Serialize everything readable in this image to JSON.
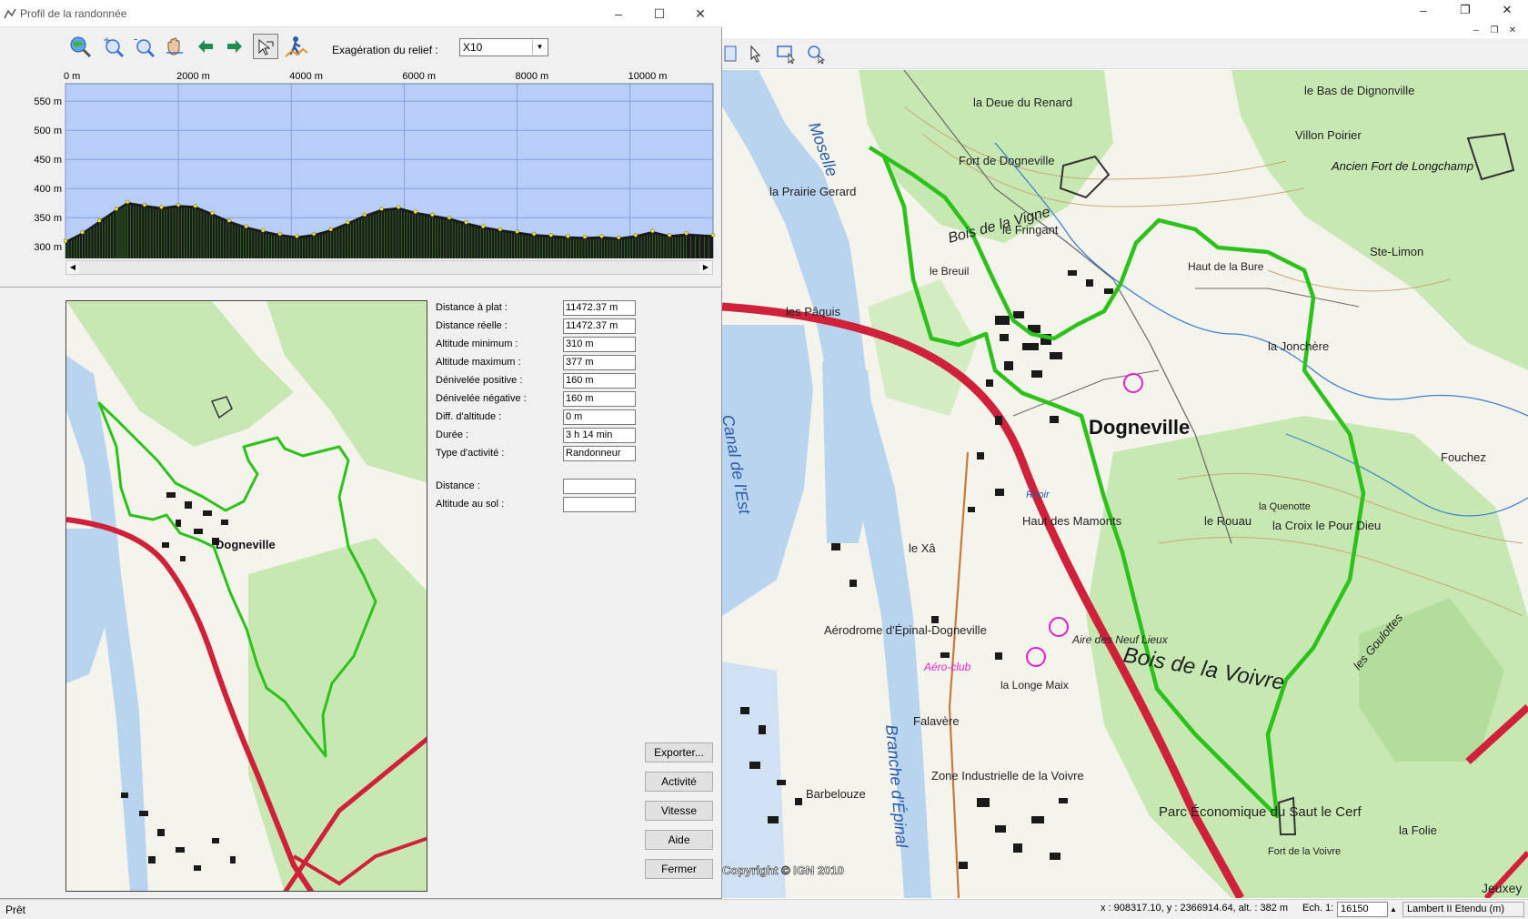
{
  "dialog": {
    "title": "Profil de la randonnée",
    "toolbar": {
      "relief_label": "Exagération du relief :",
      "relief_value": "X10"
    }
  },
  "profile": {
    "x_ticks": [
      "0 m",
      "2000 m",
      "4000 m",
      "6000 m",
      "8000 m",
      "10000 m"
    ],
    "y_ticks": [
      "550 m",
      "500 m",
      "450 m",
      "400 m",
      "350 m",
      "300 m"
    ]
  },
  "chart_data": {
    "type": "area",
    "title": "",
    "xlabel": "",
    "ylabel": "",
    "x_unit": "m",
    "y_unit": "m",
    "xlim": [
      0,
      11472
    ],
    "ylim": [
      280,
      580
    ],
    "grid": true,
    "fill_color": "#1a1a1a",
    "background_color": "#b8cdf7",
    "x": [
      0,
      300,
      600,
      900,
      1100,
      1400,
      1700,
      2000,
      2300,
      2600,
      2900,
      3200,
      3500,
      3800,
      4100,
      4400,
      4700,
      5000,
      5300,
      5600,
      5900,
      6200,
      6500,
      6800,
      7100,
      7400,
      7700,
      8000,
      8300,
      8600,
      8900,
      9200,
      9500,
      9800,
      10100,
      10400,
      10700,
      11000,
      11472
    ],
    "y": [
      310,
      325,
      345,
      365,
      377,
      372,
      368,
      372,
      370,
      358,
      345,
      335,
      328,
      322,
      318,
      322,
      330,
      342,
      355,
      365,
      368,
      360,
      355,
      350,
      342,
      335,
      330,
      326,
      322,
      320,
      318,
      317,
      318,
      316,
      320,
      327,
      320,
      323,
      320
    ]
  },
  "stats": [
    {
      "label": "Distance à plat :",
      "value": "11472.37 m"
    },
    {
      "label": "Distance réelle :",
      "value": "11472.37 m"
    },
    {
      "label": "Altitude minimum :",
      "value": "310 m"
    },
    {
      "label": "Altitude maximum :",
      "value": "377 m"
    },
    {
      "label": "Dénivelée positive :",
      "value": "160 m"
    },
    {
      "label": "Dénivelée négative :",
      "value": "160 m"
    },
    {
      "label": "Diff. d'altitude :",
      "value": "0 m"
    },
    {
      "label": "Durée :",
      "value": "3 h 14 min"
    },
    {
      "label": "Type d'activité :",
      "value": "Randonneur"
    }
  ],
  "cursor_stats": [
    {
      "label": "Distance :",
      "value": ""
    },
    {
      "label": "Altitude au sol :",
      "value": ""
    }
  ],
  "buttons": {
    "export": "Exporter...",
    "activity": "Activité",
    "speed": "Vitesse",
    "help": "Aide",
    "close": "Fermer"
  },
  "map_labels": {
    "town": "Dogneville",
    "fort": "Fort de Dogneville",
    "bois_vigne": "Bois de la Vigne",
    "aerodrome": "Aérodrome d'Épinal-Dogneville",
    "aero_club": "Aéro-club",
    "zone": "Zone Industrielle de la Voivre",
    "parc": "Parc Économique du Saut le Cerf",
    "canal": "Canal de l'Est",
    "branche": "Branche d'Épinal",
    "moselle": "Moselle",
    "bois_voivre": "Bois de la Voivre",
    "haut_bure": "Haut de la Bure",
    "haut_mamonts": "Haut des Mamonts",
    "villon": "Villon Poirier",
    "longchamp": "Ancien Fort de Longchamp",
    "jonchere": "la Jonchère",
    "fouchez": "Fouchez",
    "goulottes": "les Goulottes",
    "copyright": "Copyright © IGN 2010",
    "paquis": "les Pâquis",
    "xa": "le Xâ",
    "rouau": "le Rouau",
    "croix": "la Croix le Pour Dieu",
    "aire": "Aire des Neuf Lieux",
    "folie": "la Folie",
    "fort_voivre": "Fort de la Voivre",
    "falavere": "Falavère",
    "barbelouze": "Barbelouze",
    "fringant": "le Fringant",
    "breuil": "le Breuil",
    "longe": "la Longe Maix",
    "prairie": "la Prairie Gerard",
    "deue": "la Deue du Renard",
    "bas_dignonville": "le Bas de Dignonville",
    "limon": "Ste-Limon",
    "quenotte": "la Quenotte",
    "jeuxey": "Jeuxey",
    "rvoir": "Rvoir"
  },
  "app": {
    "status_left": "Prêt",
    "coords": "x : 908317.10, y : 2366914.64, alt. : 382 m",
    "scale_label": "Ech. 1:",
    "scale_value": "16150",
    "projection": "Lambert II Etendu (m)"
  },
  "colors": {
    "track": "#2cc21a",
    "road_major": "#d0213a",
    "forest": "#c7e8b2",
    "water": "#b8d4ee",
    "relief_bg": "#b8cdf7"
  }
}
